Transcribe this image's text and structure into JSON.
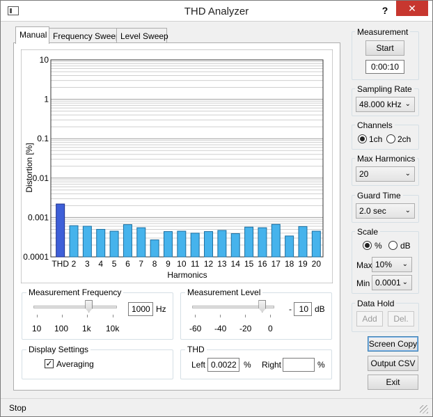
{
  "window": {
    "title": "THD Analyzer",
    "help": "?",
    "close": "✕"
  },
  "tabs": [
    "Manual",
    "Frequency Sweep",
    "Level Sweep"
  ],
  "chart_data": {
    "type": "bar",
    "ylabel": "Distortion [%]",
    "xlabel": "Harmonics",
    "yscale": "log",
    "ylim": [
      0.0001,
      10
    ],
    "ytick_labels": [
      "10",
      "1",
      "0.1",
      "0.01",
      "0.001",
      "0.0001"
    ],
    "categories": [
      "THD",
      "2",
      "3",
      "4",
      "5",
      "6",
      "7",
      "8",
      "9",
      "10",
      "11",
      "12",
      "13",
      "14",
      "15",
      "16",
      "17",
      "18",
      "19",
      "20"
    ],
    "values": [
      0.0022,
      0.00062,
      0.0006,
      0.0005,
      0.00045,
      0.00066,
      0.00055,
      0.00027,
      0.00044,
      0.00045,
      0.0004,
      0.00044,
      0.00047,
      0.00039,
      0.00057,
      0.00055,
      0.00067,
      0.00034,
      0.00059,
      0.00045
    ],
    "colors": {
      "thd": "#3e5fd8",
      "harmonic": "#46b3ec"
    }
  },
  "freq": {
    "title": "Measurement Frequency",
    "value": "1000",
    "unit": "Hz",
    "ticks": [
      "10",
      "100",
      "1k",
      "10k"
    ],
    "slider_fraction": 0.66
  },
  "level": {
    "title": "Measurement Level",
    "prefix": "-",
    "value": "10",
    "unit": "dB",
    "ticks": [
      "-60",
      "-40",
      "-20",
      "0"
    ],
    "slider_fraction": 0.85
  },
  "display": {
    "title": "Display Settings",
    "averaging": "Averaging",
    "averaging_checked": true
  },
  "thd": {
    "title": "THD",
    "left_label": "Left",
    "left_value": "0.0022",
    "left_unit": "%",
    "right_label": "Right",
    "right_value": "",
    "right_unit": "%"
  },
  "measurement": {
    "title": "Measurement",
    "start": "Start",
    "timer": "0:00:10"
  },
  "sampling": {
    "title": "Sampling Rate",
    "value": "48.000 kHz"
  },
  "channels": {
    "title": "Channels",
    "opt1": "1ch",
    "opt2": "2ch",
    "selected": "1ch"
  },
  "harmonics": {
    "title": "Max Harmonics",
    "value": "20"
  },
  "guard": {
    "title": "Guard Time",
    "value": "2.0 sec"
  },
  "scale": {
    "title": "Scale",
    "opt1": "%",
    "opt2": "dB",
    "selected": "%",
    "max_label": "Max",
    "max_value": "10%",
    "min_label": "Min",
    "min_value": "0.0001"
  },
  "datahold": {
    "title": "Data Hold",
    "add": "Add",
    "del": "Del."
  },
  "actions": {
    "screen_copy": "Screen Copy",
    "output_csv": "Output CSV",
    "exit": "Exit"
  },
  "status": {
    "text": "Stop"
  }
}
